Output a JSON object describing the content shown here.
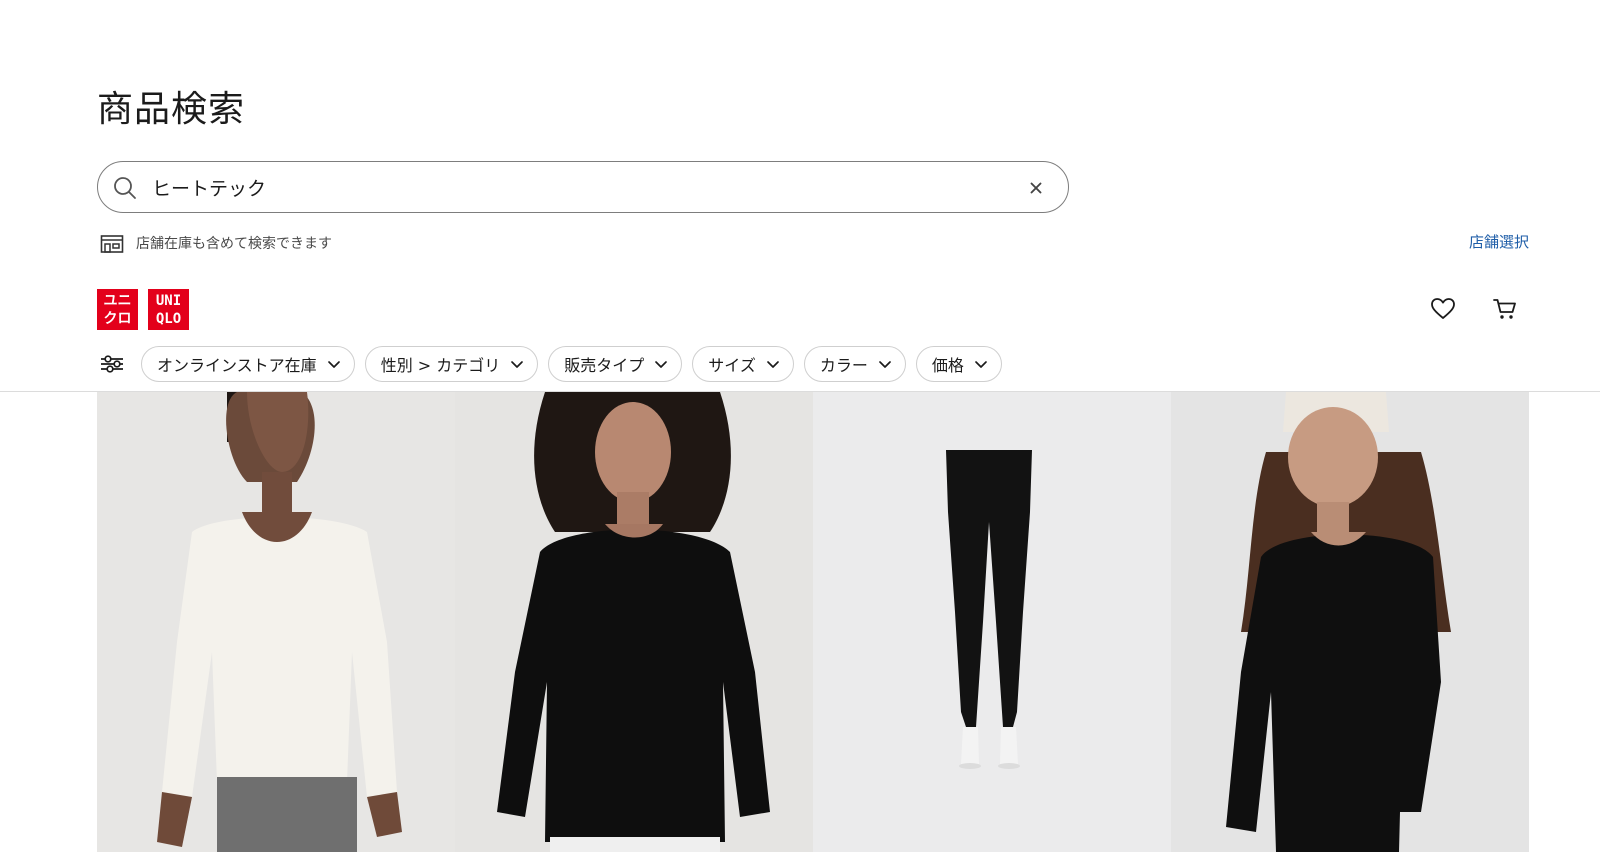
{
  "page": {
    "title": "商品検索"
  },
  "search": {
    "value": "ヒートテック"
  },
  "store": {
    "note": "店舗在庫も含めて検索できます",
    "select_label": "店舗選択"
  },
  "brand": {
    "logo_line1_a": "ユニ",
    "logo_line2_a": "クロ",
    "logo_line1_b": "UNI",
    "logo_line2_b": "QLO",
    "color": "#e3001b"
  },
  "header": {
    "icons": [
      "heart-icon",
      "cart-icon"
    ]
  },
  "filters": [
    {
      "label": "オンラインストア在庫"
    },
    {
      "label": "性別 > カテゴリ"
    },
    {
      "label": "販売タイプ"
    },
    {
      "label": "サイズ"
    },
    {
      "label": "カラー"
    },
    {
      "label": "価格"
    }
  ],
  "products": [
    {
      "image": "white-scoop-neck-long-sleeve-top"
    },
    {
      "image": "black-crew-neck-long-sleeve-top"
    },
    {
      "image": "black-leggings"
    },
    {
      "image": "black-long-sleeve-top-beanie"
    }
  ],
  "colors": {
    "accent_link": "#1f5ea8",
    "border": "#7d7d7d",
    "chip_border": "#cfcfcf",
    "image_bg": "#e9e9ea"
  }
}
